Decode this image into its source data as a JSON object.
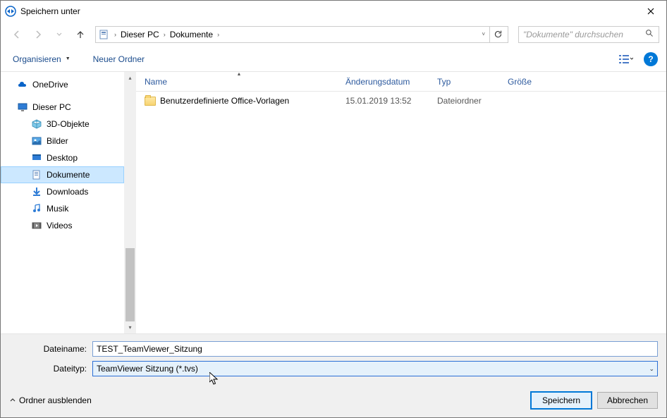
{
  "title": "Speichern unter",
  "breadcrumb": {
    "root": "Dieser PC",
    "current": "Dokumente"
  },
  "search": {
    "placeholder": "\"Dokumente\" durchsuchen"
  },
  "toolbar": {
    "organize": "Organisieren",
    "newfolder": "Neuer Ordner"
  },
  "headers": {
    "name": "Name",
    "modified": "Änderungsdatum",
    "type": "Typ",
    "size": "Größe"
  },
  "sidebar": {
    "onedrive": "OneDrive",
    "pc": "Dieser PC",
    "items": [
      {
        "label": "3D-Objekte"
      },
      {
        "label": "Bilder"
      },
      {
        "label": "Desktop"
      },
      {
        "label": "Dokumente"
      },
      {
        "label": "Downloads"
      },
      {
        "label": "Musik"
      },
      {
        "label": "Videos"
      }
    ]
  },
  "files": [
    {
      "name": "Benutzerdefinierte Office-Vorlagen",
      "modified": "15.01.2019 13:52",
      "type": "Dateiordner",
      "size": ""
    }
  ],
  "labels": {
    "filename": "Dateiname:",
    "filetype": "Dateityp:"
  },
  "values": {
    "filename": "TEST_TeamViewer_Sitzung",
    "filetype": "TeamViewer Sitzung (*.tvs)"
  },
  "buttons": {
    "hide": "Ordner ausblenden",
    "save": "Speichern",
    "cancel": "Abbrechen"
  }
}
